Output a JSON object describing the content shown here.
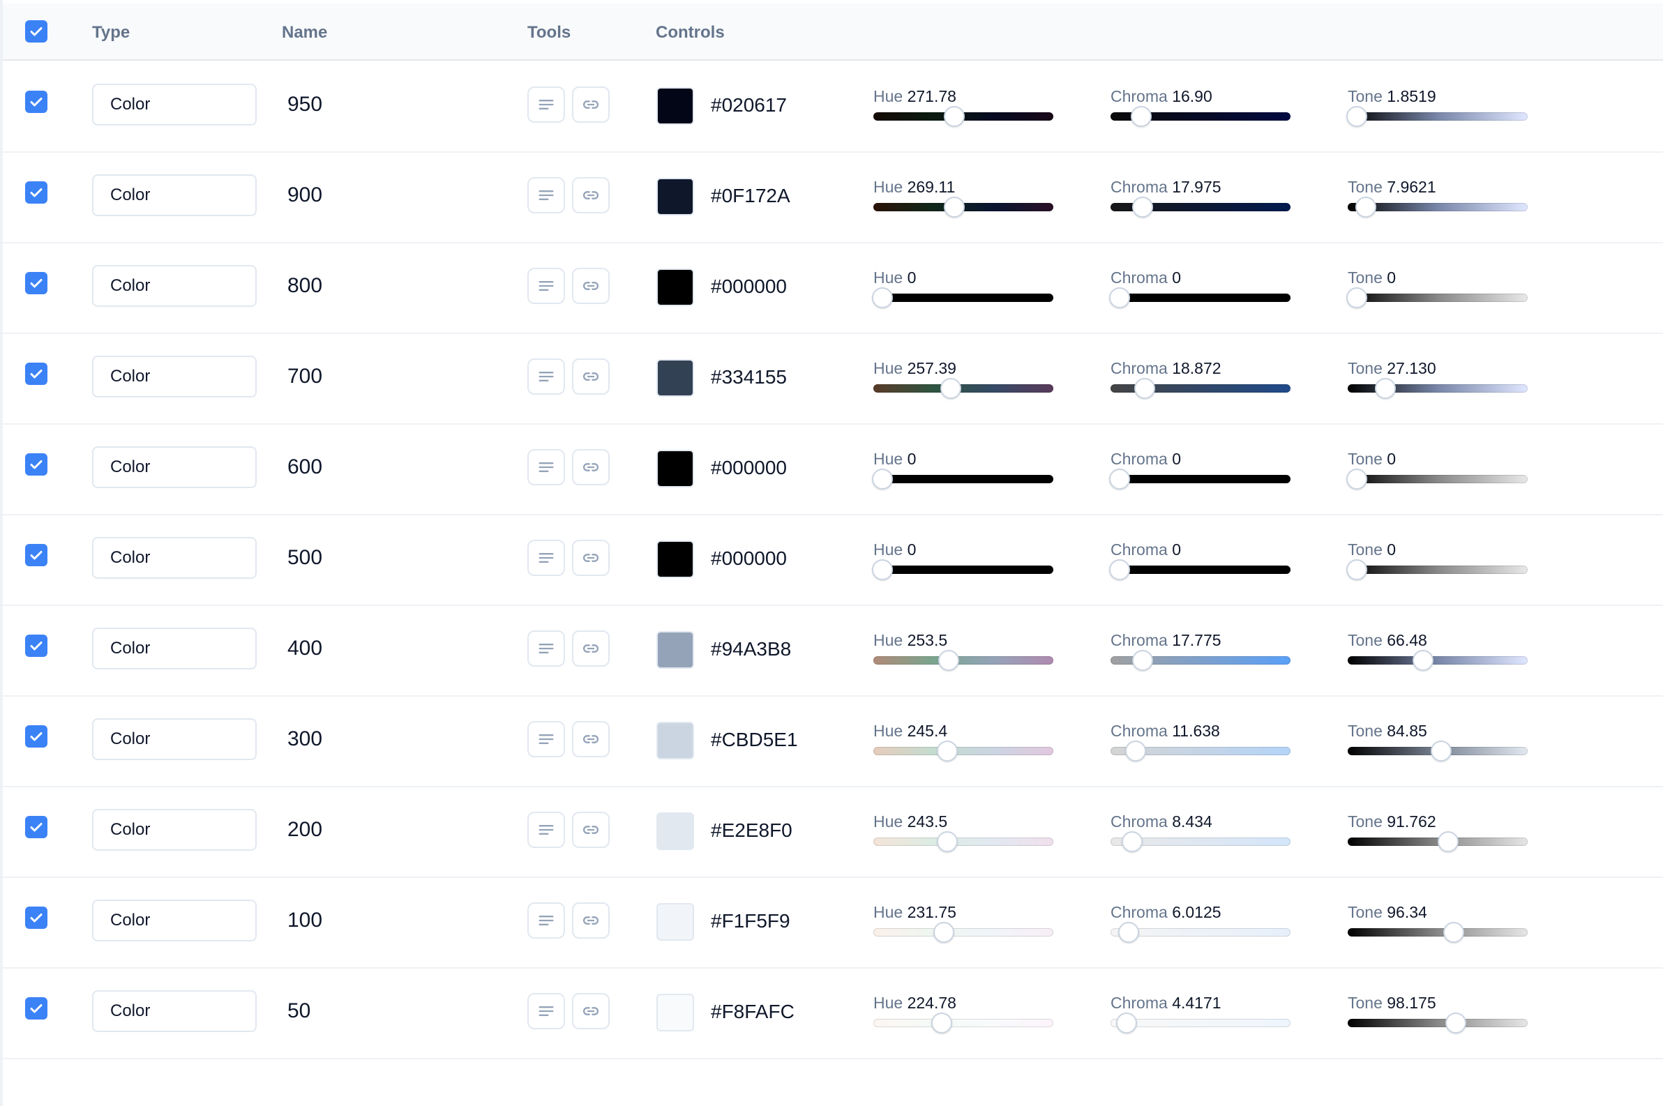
{
  "header": {
    "select_all_checked": true,
    "columns": {
      "type": "Type",
      "name": "Name",
      "tools": "Tools",
      "controls": "Controls"
    }
  },
  "control_labels": {
    "hue": "Hue",
    "chroma": "Chroma",
    "tone": "Tone"
  },
  "rows": [
    {
      "checked": true,
      "type": "Color",
      "name": "950",
      "hex": "#020617",
      "hue": "271.78",
      "hue_pos": 0.45,
      "chroma": "16.90",
      "chroma_pos": 0.17,
      "tone": "1.8519",
      "tone_pos": 0.05,
      "hue_grad": "linear-gradient(90deg,#140a05,#0a1a10,#060a20,#180818)",
      "chroma_grad": "linear-gradient(90deg,#0a0a0a,#020a40)",
      "tone_grad": "linear-gradient(90deg,#000000,#7886a8,#e0e7ff)"
    },
    {
      "checked": true,
      "type": "Color",
      "name": "900",
      "hex": "#0F172A",
      "hue": "269.11",
      "hue_pos": 0.45,
      "chroma": "17.975",
      "chroma_pos": 0.18,
      "tone": "7.9621",
      "tone_pos": 0.1,
      "hue_grad": "linear-gradient(90deg,#2a1208,#10261a,#0a1430,#2a1028)",
      "chroma_grad": "linear-gradient(90deg,#171717,#03194f)",
      "tone_grad": "linear-gradient(90deg,#000000,#7886a8,#e0e7ff)"
    },
    {
      "checked": true,
      "type": "Color",
      "name": "800",
      "hex": "#000000",
      "hue": "0",
      "hue_pos": 0.05,
      "chroma": "0",
      "chroma_pos": 0.05,
      "tone": "0",
      "tone_pos": 0.05,
      "hue_grad": "linear-gradient(90deg,#000000,#000000)",
      "chroma_grad": "linear-gradient(90deg,#000000,#000000)",
      "tone_grad": "linear-gradient(90deg,#000000,#888888,#e8e8e8)"
    },
    {
      "checked": true,
      "type": "Color",
      "name": "700",
      "hex": "#334155",
      "hue": "257.39",
      "hue_pos": 0.43,
      "chroma": "18.872",
      "chroma_pos": 0.19,
      "tone": "27.130",
      "tone_pos": 0.21,
      "hue_grad": "linear-gradient(90deg,#5a3a28,#2e5540,#354a66,#5a3a5a)",
      "chroma_grad": "linear-gradient(90deg,#444444,#1f4a8a)",
      "tone_grad": "linear-gradient(90deg,#000000,#7886a8,#e0e7ff)"
    },
    {
      "checked": true,
      "type": "Color",
      "name": "600",
      "hex": "#000000",
      "hue": "0",
      "hue_pos": 0.05,
      "chroma": "0",
      "chroma_pos": 0.05,
      "tone": "0",
      "tone_pos": 0.05,
      "hue_grad": "linear-gradient(90deg,#000000,#000000)",
      "chroma_grad": "linear-gradient(90deg,#000000,#000000)",
      "tone_grad": "linear-gradient(90deg,#000000,#888888,#e8e8e8)"
    },
    {
      "checked": true,
      "type": "Color",
      "name": "500",
      "hex": "#000000",
      "hue": "0",
      "hue_pos": 0.05,
      "chroma": "0",
      "chroma_pos": 0.05,
      "tone": "0",
      "tone_pos": 0.05,
      "hue_grad": "linear-gradient(90deg,#000000,#000000)",
      "chroma_grad": "linear-gradient(90deg,#000000,#000000)",
      "tone_grad": "linear-gradient(90deg,#000000,#888888,#e8e8e8)"
    },
    {
      "checked": true,
      "type": "Color",
      "name": "400",
      "hex": "#94A3B8",
      "hue": "253.5",
      "hue_pos": 0.42,
      "chroma": "17.775",
      "chroma_pos": 0.18,
      "tone": "66.48",
      "tone_pos": 0.42,
      "hue_grad": "linear-gradient(90deg,#b08a78,#7aa58e,#94a3b8,#b08ab0)",
      "chroma_grad": "linear-gradient(90deg,#a0a0a0,#5aa0f8)",
      "tone_grad": "linear-gradient(90deg,#000000,#7886a8,#e0e7ff)"
    },
    {
      "checked": true,
      "type": "Color",
      "name": "300",
      "hex": "#CBD5E1",
      "hue": "245.4",
      "hue_pos": 0.41,
      "chroma": "11.638",
      "chroma_pos": 0.14,
      "tone": "84.85",
      "tone_pos": 0.52,
      "hue_grad": "linear-gradient(90deg,#e6ccbc,#c4dcd0,#cbd5e1,#e2c8e0)",
      "chroma_grad": "linear-gradient(90deg,#d4d4d4,#b4d4f8)",
      "tone_grad": "linear-gradient(90deg,#000000,#7a8494,#e2e8f0)"
    },
    {
      "checked": true,
      "type": "Color",
      "name": "200",
      "hex": "#E2E8F0",
      "hue": "243.5",
      "hue_pos": 0.41,
      "chroma": "8.434",
      "chroma_pos": 0.12,
      "tone": "91.762",
      "tone_pos": 0.56,
      "hue_grad": "linear-gradient(90deg,#f4e4d8,#dcece4,#e2e8f0,#f0e0ec)",
      "chroma_grad": "linear-gradient(90deg,#e8e8e8,#d4e6fa)",
      "tone_grad": "linear-gradient(90deg,#000000,#888888,#e6e6e6)"
    },
    {
      "checked": true,
      "type": "Color",
      "name": "100",
      "hex": "#F1F5F9",
      "hue": "231.75",
      "hue_pos": 0.39,
      "chroma": "6.0125",
      "chroma_pos": 0.1,
      "tone": "96.34",
      "tone_pos": 0.59,
      "hue_grad": "linear-gradient(90deg,#fbf0ea,#edf6f2,#f1f5f9,#f8eef6)",
      "chroma_grad": "linear-gradient(90deg,#f4f4f4,#e6f0fb)",
      "tone_grad": "linear-gradient(90deg,#000000,#888888,#e6e6e6)"
    },
    {
      "checked": true,
      "type": "Color",
      "name": "50",
      "hex": "#F8FAFC",
      "hue": "224.78",
      "hue_pos": 0.38,
      "chroma": "4.4171",
      "chroma_pos": 0.09,
      "tone": "98.175",
      "tone_pos": 0.6,
      "hue_grad": "linear-gradient(90deg,#fdf6f2,#f4faf7,#f8fafc,#fcf4fa)",
      "chroma_grad": "linear-gradient(90deg,#f8f8f8,#eef5fc)",
      "tone_grad": "linear-gradient(90deg,#000000,#888888,#e6e6e6)"
    }
  ]
}
